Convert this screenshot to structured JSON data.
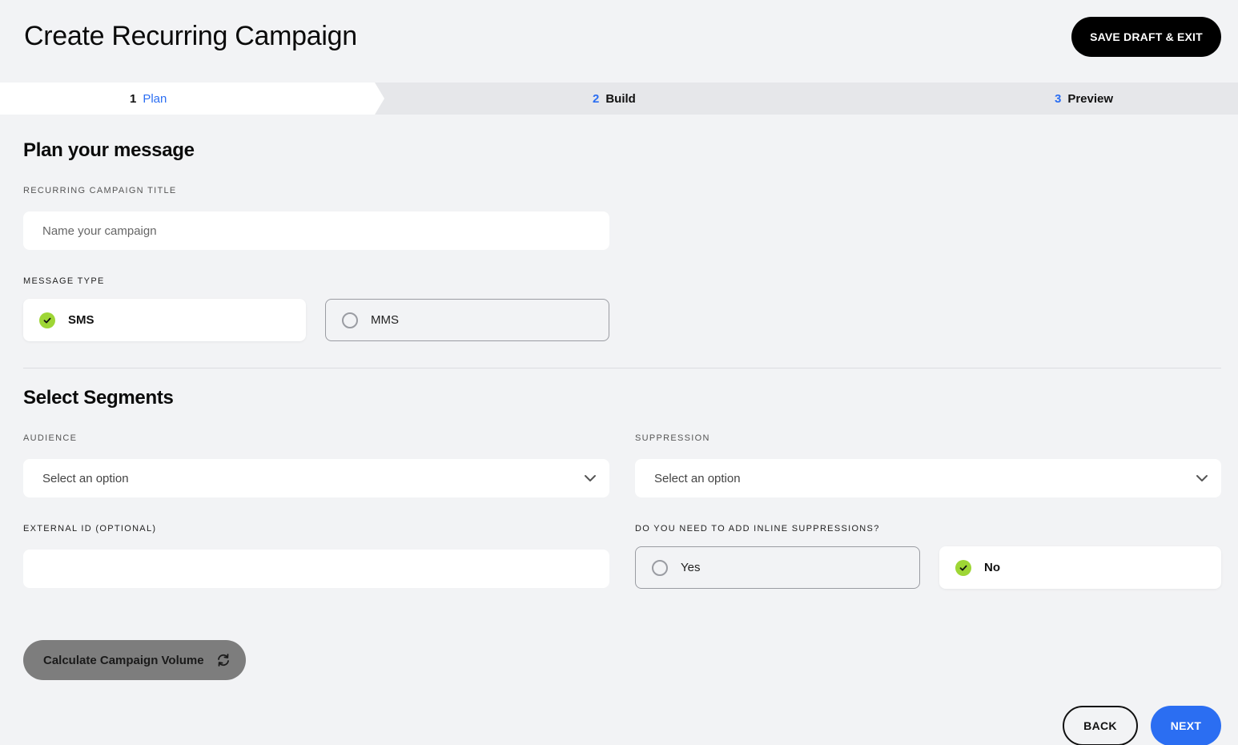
{
  "header": {
    "title": "Create Recurring Campaign",
    "save_exit_label": "SAVE DRAFT & EXIT"
  },
  "stepper": {
    "steps": [
      {
        "num": "1",
        "label": "Plan",
        "active": true
      },
      {
        "num": "2",
        "label": "Build",
        "active": false
      },
      {
        "num": "3",
        "label": "Preview",
        "active": false
      }
    ]
  },
  "plan": {
    "section_title": "Plan your message",
    "campaign_title_label": "RECURRING CAMPAIGN TITLE",
    "campaign_title_placeholder": "Name your campaign",
    "campaign_title_value": "",
    "message_type_label": "MESSAGE TYPE",
    "message_type_options": [
      {
        "label": "SMS",
        "selected": true
      },
      {
        "label": "MMS",
        "selected": false
      }
    ]
  },
  "segments": {
    "section_title": "Select Segments",
    "audience_label": "AUDIENCE",
    "audience_value": "Select an option",
    "suppression_label": "SUPPRESSION",
    "suppression_value": "Select an option",
    "external_id_label": "EXTERNAL ID (OPTIONAL)",
    "external_id_value": "",
    "inline_label": "DO YOU NEED TO ADD INLINE SUPPRESSIONS?",
    "inline_options": [
      {
        "label": "Yes",
        "selected": false
      },
      {
        "label": "No",
        "selected": true
      }
    ]
  },
  "actions": {
    "calculate_label": "Calculate Campaign Volume",
    "back_label": "BACK",
    "next_label": "NEXT"
  },
  "colors": {
    "accent_blue": "#2b6ef2",
    "check_green": "#9ed635",
    "background": "#f2f3f5"
  },
  "icons": {
    "check": "check-icon",
    "chevron": "chevron-down-icon",
    "refresh": "refresh-icon"
  }
}
